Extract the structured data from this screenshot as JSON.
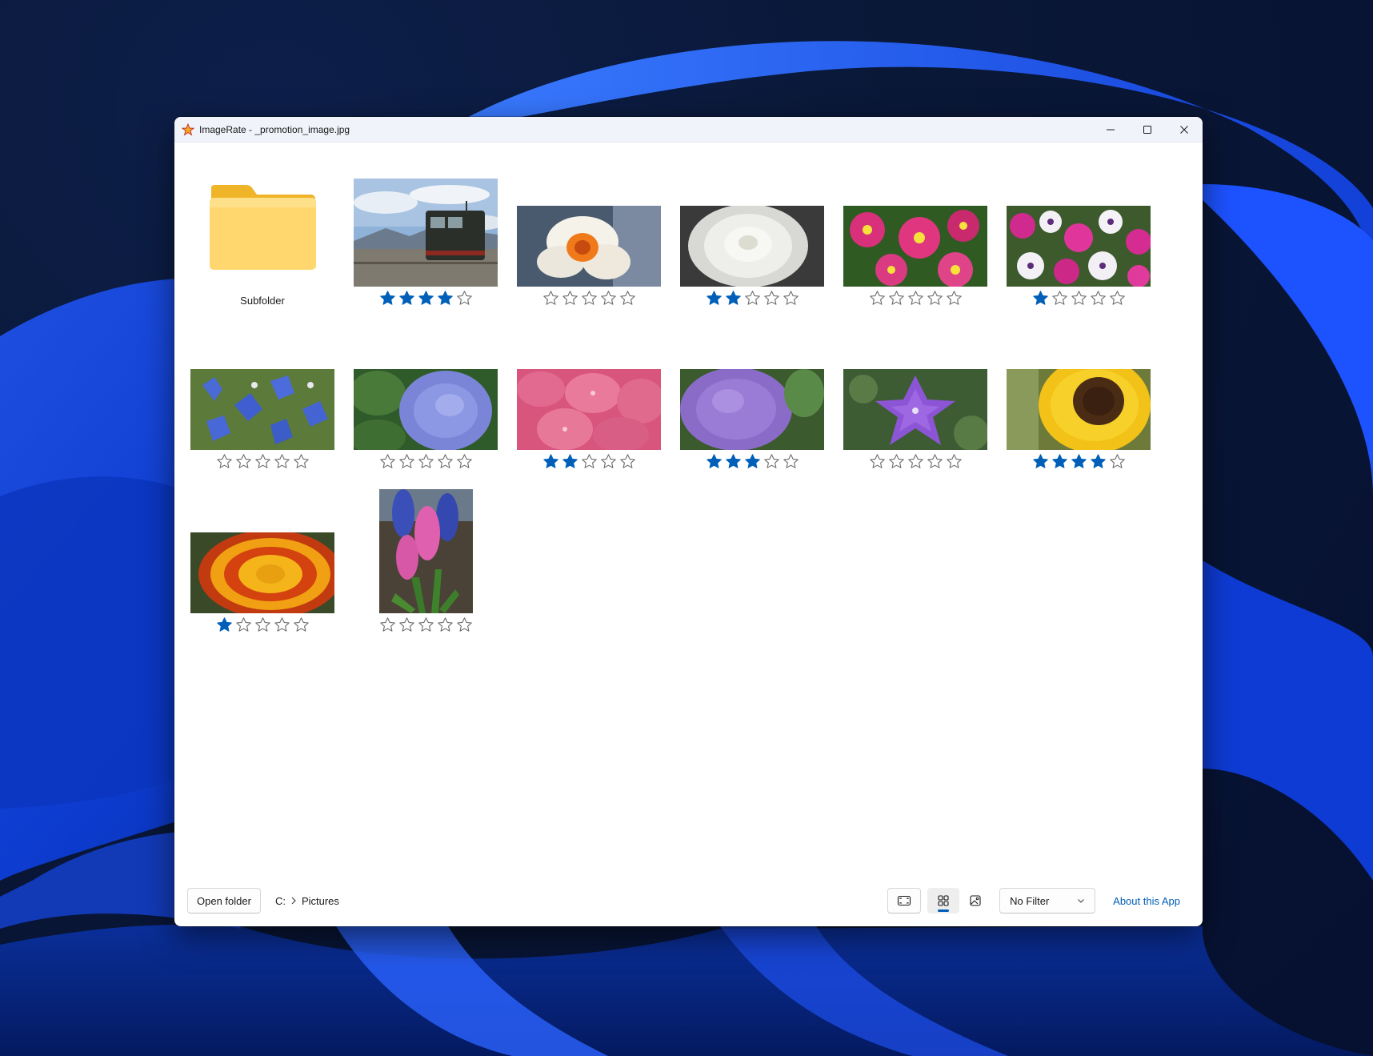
{
  "window": {
    "title": "ImageRate - _promotion_image.jpg",
    "controls": [
      "minimize-icon",
      "maximize-icon",
      "close-icon"
    ]
  },
  "colors": {
    "accent": "#005fb8",
    "star_filled": "#005fb8",
    "star_empty": "#6b6b6b"
  },
  "folder": {
    "label": "Subfolder",
    "icon": "folder-icon"
  },
  "images": [
    {
      "name": "train",
      "rating": 4
    },
    {
      "name": "daffodil",
      "rating": 0
    },
    {
      "name": "white-dahlia",
      "rating": 2
    },
    {
      "name": "pink-primula",
      "rating": 0
    },
    {
      "name": "petunias",
      "rating": 1
    },
    {
      "name": "blue-gentian",
      "rating": 0
    },
    {
      "name": "blue-hydrangea",
      "rating": 0
    },
    {
      "name": "pink-hydrangea",
      "rating": 2
    },
    {
      "name": "purple-hydrangea",
      "rating": 3
    },
    {
      "name": "balloon-flower",
      "rating": 0
    },
    {
      "name": "sunflower",
      "rating": 4
    },
    {
      "name": "marigold",
      "rating": 1
    },
    {
      "name": "hyacinths",
      "rating": 0
    }
  ],
  "max_rating": 5,
  "toolbar": {
    "open_folder_label": "Open folder",
    "breadcrumb": [
      "C:",
      "Pictures"
    ],
    "view_buttons": [
      "fullscreen-icon",
      "grid-view-icon",
      "single-image-icon"
    ],
    "active_view": "grid-view-icon",
    "filter_value": "No Filter",
    "about_label": "About this App"
  }
}
